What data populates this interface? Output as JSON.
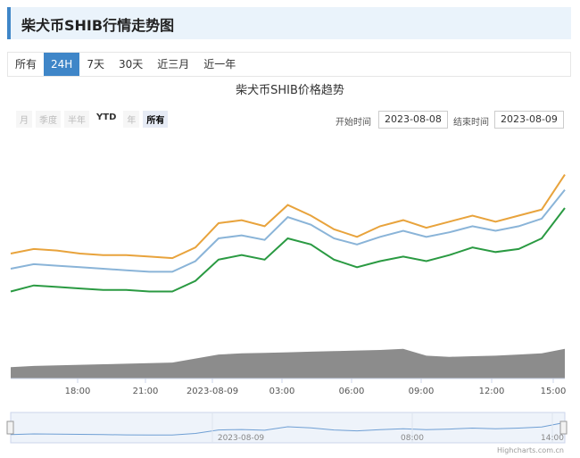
{
  "page": {
    "title": "柴犬币SHIB行情走势图"
  },
  "tabs": [
    {
      "label": "所有",
      "active": false
    },
    {
      "label": "24H",
      "active": true
    },
    {
      "label": "7天",
      "active": false
    },
    {
      "label": "30天",
      "active": false
    },
    {
      "label": "近三月",
      "active": false
    },
    {
      "label": "近一年",
      "active": false
    }
  ],
  "range_selector": {
    "buttons": [
      "月",
      "季度",
      "半年",
      "YTD",
      "年",
      "所有"
    ],
    "start_label": "开始时间",
    "start_value": "2023-08-08",
    "end_label": "结束时间",
    "end_value": "2023-08-09"
  },
  "colors": {
    "accent": "#3f86c8",
    "high": "#e8a33c",
    "mid": "#8ab4d8",
    "low": "#2a9a42",
    "volume": "#8c8c8c"
  },
  "chart_data": {
    "type": "line",
    "title": "柴犬币SHIB价格趋势",
    "x_tick_labels": [
      "18:00",
      "21:00",
      "2023-08-09",
      "03:00",
      "06:00",
      "09:00",
      "12:00",
      "15:00"
    ],
    "x_hours": [
      0,
      1,
      2,
      3,
      4,
      5,
      6,
      7,
      8,
      9,
      10,
      11,
      12,
      13,
      14,
      15,
      16,
      17,
      18,
      19,
      20,
      21,
      22,
      23,
      24
    ],
    "x_start_time": "2023-08-08 15:00",
    "series": [
      {
        "values": [
          0.3,
          0.33,
          0.32,
          0.3,
          0.29,
          0.29,
          0.28,
          0.27,
          0.34,
          0.5,
          0.52,
          0.48,
          0.62,
          0.55,
          0.46,
          0.41,
          0.48,
          0.52,
          0.47,
          0.51,
          0.55,
          0.51,
          0.55,
          0.59,
          0.82
        ]
      },
      {
        "values": [
          0.2,
          0.23,
          0.22,
          0.21,
          0.2,
          0.19,
          0.18,
          0.18,
          0.25,
          0.4,
          0.42,
          0.39,
          0.54,
          0.49,
          0.4,
          0.36,
          0.41,
          0.45,
          0.41,
          0.44,
          0.48,
          0.45,
          0.48,
          0.53,
          0.72
        ]
      },
      {
        "values": [
          0.05,
          0.09,
          0.08,
          0.07,
          0.06,
          0.06,
          0.05,
          0.05,
          0.12,
          0.26,
          0.29,
          0.26,
          0.4,
          0.36,
          0.26,
          0.21,
          0.25,
          0.28,
          0.25,
          0.29,
          0.34,
          0.31,
          0.33,
          0.4,
          0.6
        ]
      }
    ],
    "volume": [
      0.2,
      0.22,
      0.23,
      0.24,
      0.25,
      0.26,
      0.27,
      0.28,
      0.35,
      0.42,
      0.44,
      0.45,
      0.46,
      0.47,
      0.48,
      0.49,
      0.5,
      0.52,
      0.4,
      0.38,
      0.39,
      0.4,
      0.42,
      0.44,
      0.52
    ],
    "navigator_labels": [
      "2023-08-09",
      "08:00",
      "14:00"
    ],
    "credits": "Highcharts.com.cn"
  }
}
